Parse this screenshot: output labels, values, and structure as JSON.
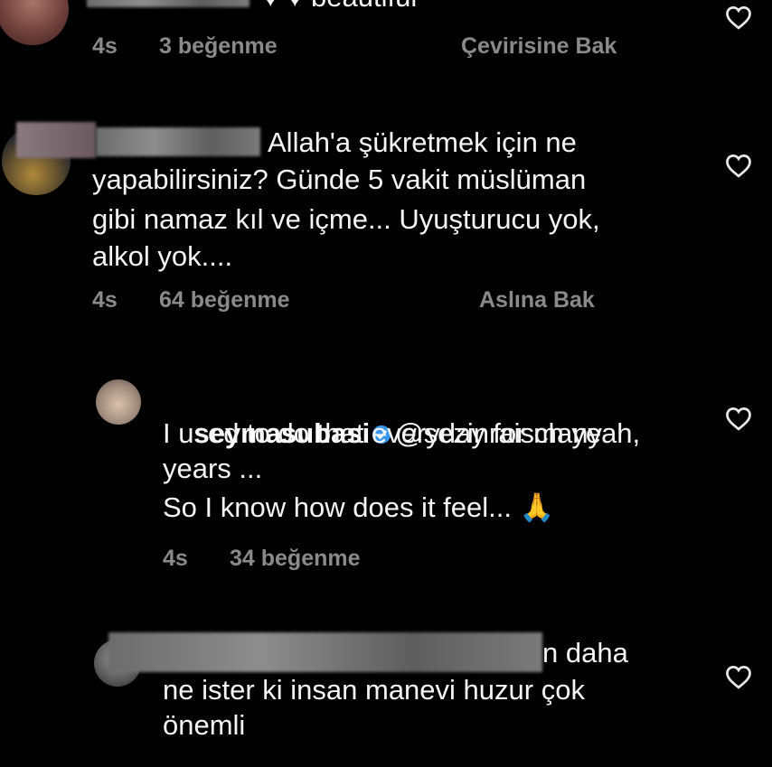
{
  "comments": [
    {
      "text_partial": "♥ ♥ beautiful",
      "time": "4s",
      "likes": "3 beğenme",
      "action": "Çevirisine Bak"
    },
    {
      "line1": "Allah'a şükretmek için ne",
      "line2": "yapabilirsiniz? Günde 5 vakit müslüman",
      "line3": "gibi namaz kıl ve içme... Uyuşturucu yok,",
      "line4": "alkol yok....",
      "time": "4s",
      "likes": "64 beğenme",
      "action": "Aslına Bak"
    },
    {
      "username": "seymasubasi",
      "mention": "@sezinraisch yeah,",
      "line2": "I used to do that everyday for many",
      "line3": "years ...",
      "line4": "So I know how does it feel... 🙏",
      "time": "4s",
      "likes": "34 beğenme"
    },
    {
      "line1_tail": "n daha",
      "line2": "ne ister ki insan manevi huzur çok",
      "line3": "önemli"
    }
  ],
  "icons": {
    "heart": "heart-outline-icon",
    "verified": "verified-badge-icon"
  },
  "colors": {
    "background": "#000000",
    "text": "#f4f4f4",
    "meta": "#8a8a8a",
    "verified": "#3897f0"
  }
}
